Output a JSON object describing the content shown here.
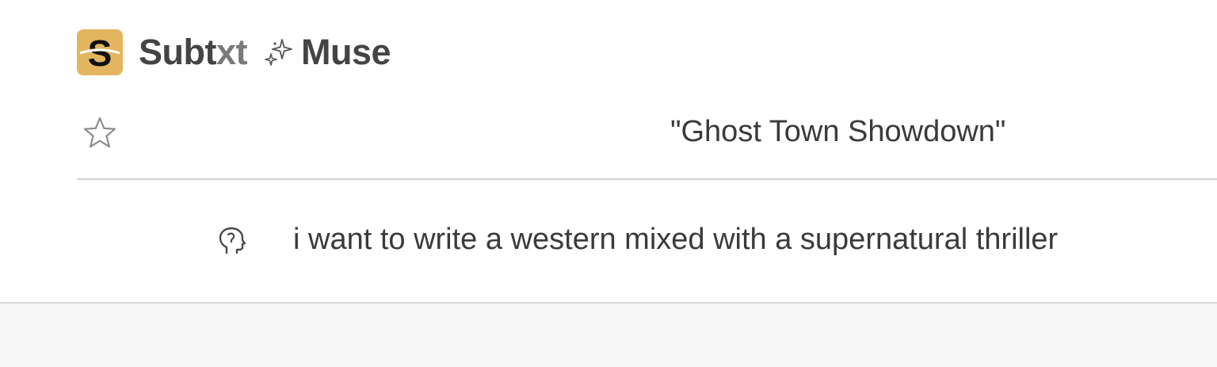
{
  "app": {
    "logo_letter": "S",
    "brand_main": "Subt",
    "brand_suffix": "xt",
    "product_name": "Muse",
    "icons": {
      "logo": "subtxt-logo-icon",
      "sparkle": "sparkle-icon",
      "favorite": "star-icon",
      "prompt": "head-profile-icon"
    },
    "colors": {
      "logo_bg": "#e3b55f",
      "text": "#3a3a3a",
      "divider": "#d2d2d2",
      "footer_bg": "#f6f6f6"
    }
  },
  "story": {
    "title": "\"Ghost Town Showdown\""
  },
  "prompt": {
    "text": "i want to write a western mixed with a supernatural thriller"
  }
}
